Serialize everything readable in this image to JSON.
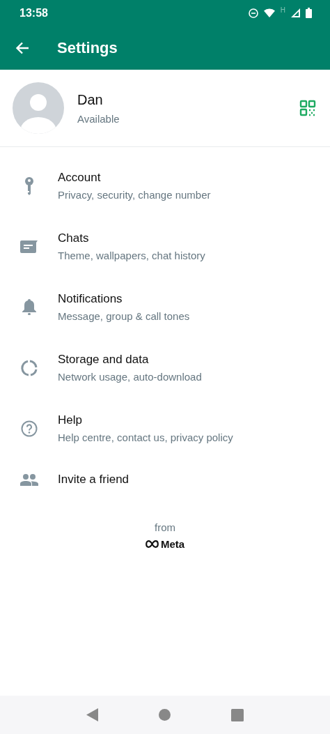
{
  "status_bar": {
    "time": "13:58",
    "network_type": "H"
  },
  "app_bar": {
    "title": "Settings"
  },
  "profile": {
    "name": "Dan",
    "status": "Available"
  },
  "menu_items": [
    {
      "title": "Account",
      "subtitle": "Privacy, security, change number"
    },
    {
      "title": "Chats",
      "subtitle": "Theme, wallpapers, chat history"
    },
    {
      "title": "Notifications",
      "subtitle": "Message, group & call tones"
    },
    {
      "title": "Storage and data",
      "subtitle": "Network usage, auto-download"
    },
    {
      "title": "Help",
      "subtitle": "Help centre, contact us, privacy policy"
    },
    {
      "title": "Invite a friend"
    }
  ],
  "footer": {
    "from": "from",
    "brand": "Meta"
  }
}
